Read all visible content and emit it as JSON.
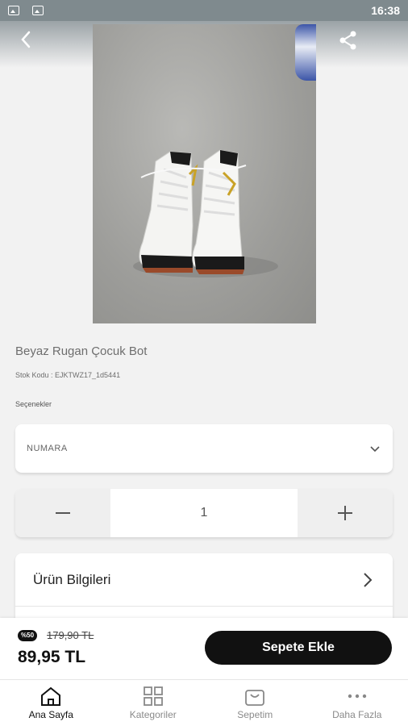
{
  "status_bar": {
    "time": "16:38"
  },
  "product": {
    "name": "Beyaz Rugan Çocuk Bot",
    "stock_code": "Stok Kodu : EJKTWZ17_1d5441",
    "options_label": "Seçenekler",
    "size_select": "NUMARA",
    "quantity": "1",
    "info_label": "Ürün Bilgileri"
  },
  "purchase": {
    "discount_badge": "%50",
    "old_price": "179,90 TL",
    "price": "89,95 TL",
    "add_to_cart": "Sepete Ekle"
  },
  "nav": {
    "items": [
      {
        "label": "Ana Sayfa",
        "icon": "home-icon"
      },
      {
        "label": "Kategoriler",
        "icon": "grid-icon"
      },
      {
        "label": "Sepetim",
        "icon": "basket-icon"
      },
      {
        "label": "Daha Fazla",
        "icon": "more-icon"
      }
    ]
  },
  "colors": {
    "accent": "#111111",
    "background": "#f2f2f2"
  }
}
